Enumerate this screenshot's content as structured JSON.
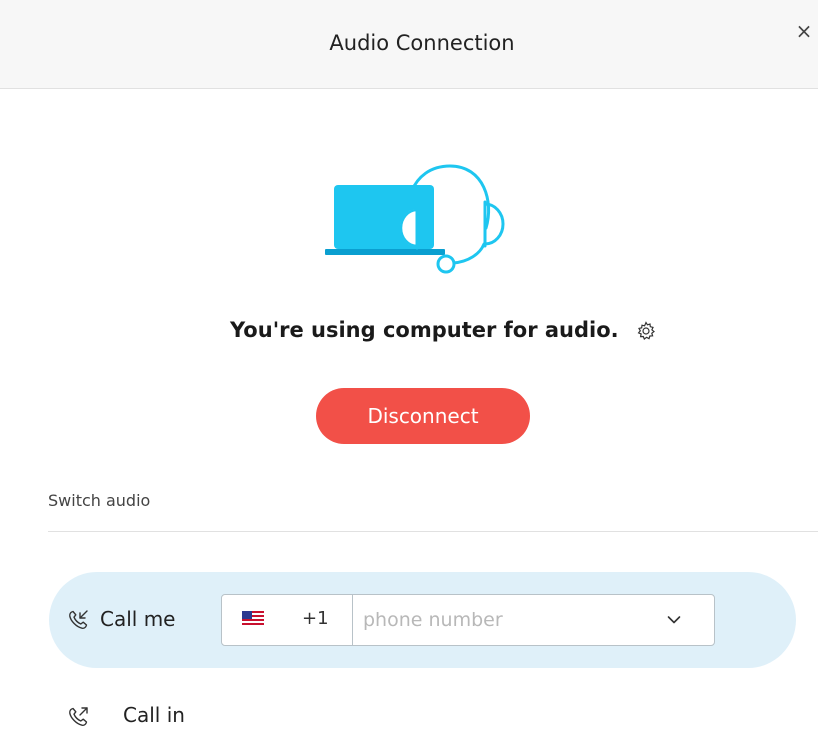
{
  "header": {
    "title": "Audio Connection",
    "close_label": "×"
  },
  "status": {
    "text": "You're using computer for audio.",
    "settings_icon": "gear-icon"
  },
  "actions": {
    "disconnect_label": "Disconnect"
  },
  "switch_audio": {
    "label": "Switch audio",
    "call_me": {
      "label": "Call me",
      "icon": "phone-incoming-icon",
      "country_code": "+1",
      "country_flag": "us-flag-icon",
      "phone_placeholder": "phone number",
      "phone_value": ""
    },
    "call_in": {
      "label": "Call in",
      "icon": "phone-outgoing-icon"
    }
  },
  "colors": {
    "accent_blue": "#1ec6f0",
    "disconnect_red": "#f25048",
    "row_highlight": "#dff0f9"
  }
}
